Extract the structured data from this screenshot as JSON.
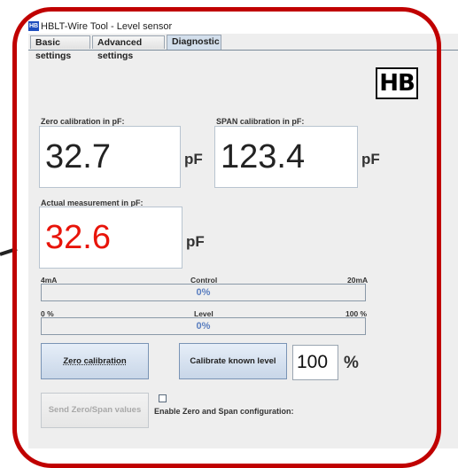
{
  "window": {
    "title": "HBLT-Wire Tool - Level sensor",
    "icon_text": "HB"
  },
  "tabs": [
    {
      "label": "Basic settings",
      "active": false
    },
    {
      "label": "Advanced settings",
      "active": false
    },
    {
      "label": "Diagnostic",
      "active": true
    }
  ],
  "logo_text": "HB",
  "zero_calibration": {
    "label": "Zero calibration in pF:",
    "value": "32.7",
    "unit": "pF"
  },
  "span_calibration": {
    "label": "SPAN calibration in pF:",
    "value": "123.4",
    "unit": "pF"
  },
  "actual_measurement": {
    "label": "Actual measurement in pF:",
    "value": "32.6",
    "unit": "pF",
    "value_color": "#e8140a"
  },
  "control_bar": {
    "left_label": "4mA",
    "center_label": "Control",
    "right_label": "20mA",
    "value_text": "0%",
    "fill_fraction": 0
  },
  "level_bar": {
    "left_label": "0 %",
    "center_label": "Level",
    "right_label": "100 %",
    "value_text": "0%",
    "fill_fraction": 0
  },
  "buttons": {
    "zero_calibration": "Zero calibration",
    "calibrate_known_level": "Calibrate known level",
    "send_zero_span": "Send Zero/Span values"
  },
  "known_level": {
    "value": "100",
    "unit": "%"
  },
  "enable_config": {
    "label": "Enable Zero and Span configuration:",
    "checked": false
  },
  "colors": {
    "highlight_frame": "#c00000",
    "bar_text": "#5b7fc0"
  }
}
